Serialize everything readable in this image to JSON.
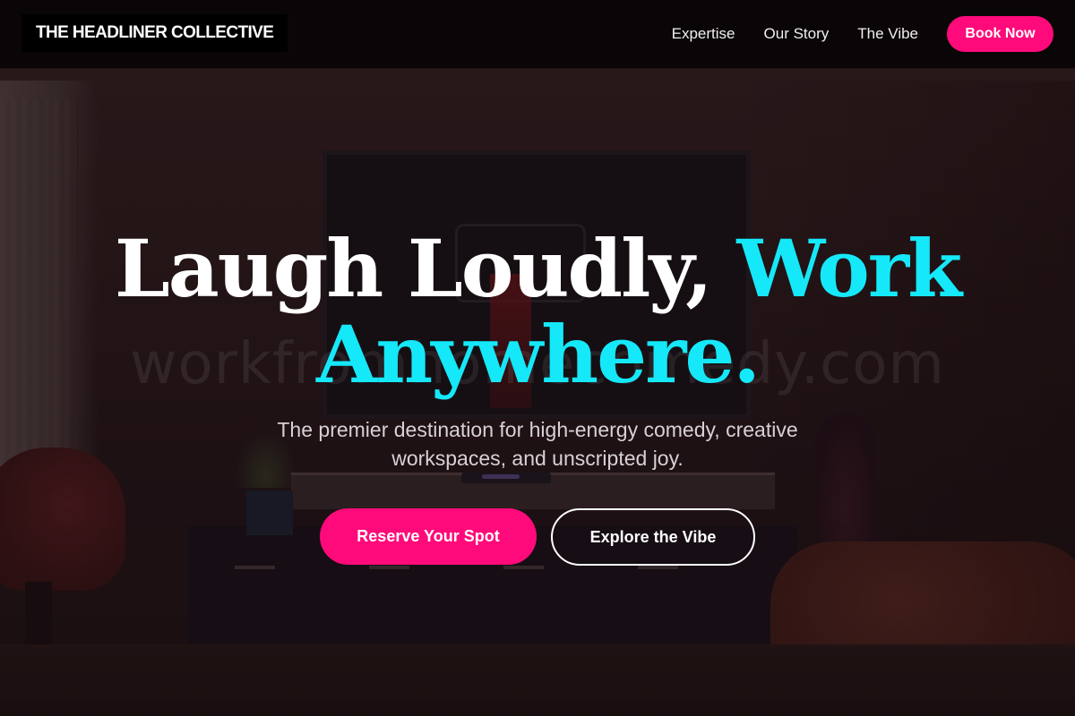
{
  "nav": {
    "brand": "THE HEADLINER COLLECTIVE",
    "links": [
      {
        "label": "Expertise"
      },
      {
        "label": "Our Story"
      },
      {
        "label": "The Vibe"
      }
    ],
    "cta_label": "Book Now"
  },
  "hero": {
    "title_part1": "Laugh Loudly, ",
    "title_part2": "Work Anywhere.",
    "subtitle": "The premier destination for high-energy comedy, creative workspaces, and unscripted joy.",
    "primary_cta": "Reserve Your Spot",
    "secondary_cta": "Explore the Vibe",
    "watermark": "workfromhomecomedy.com"
  },
  "colors": {
    "accent_pink": "#ff0a7a",
    "accent_cyan": "#15e8f8",
    "nav_background": "#0a0607"
  }
}
